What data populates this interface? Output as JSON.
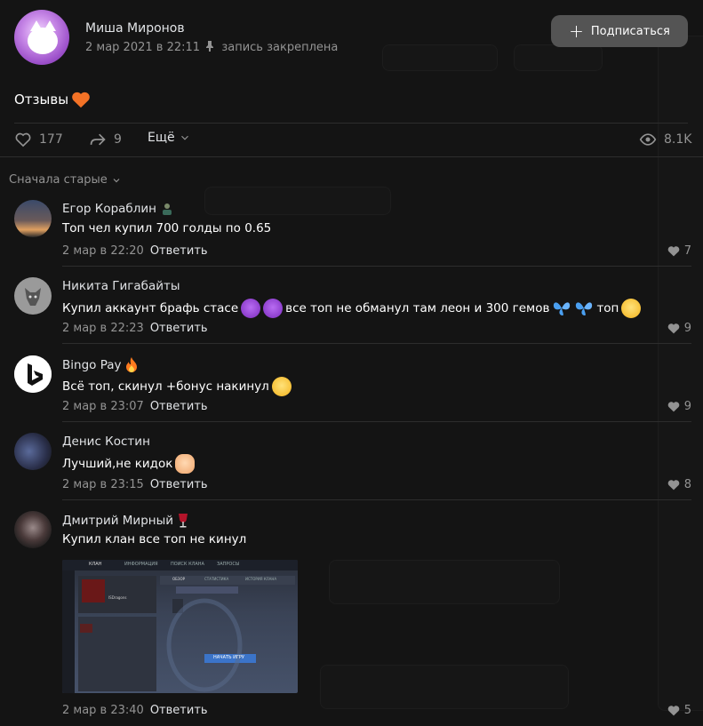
{
  "post": {
    "author": "Миша Миронов",
    "date": "2 мар 2021 в 22:11",
    "pinned_label": "запись закреплена",
    "subscribe_label": "Подписаться",
    "text": "Отзывы",
    "likes": "177",
    "shares": "9",
    "more_label": "Ещё",
    "views": "8.1K"
  },
  "sort_label": "Сначала старые",
  "reply_label": "Ответить",
  "comments": [
    {
      "name": "Егор Кораблин",
      "text": "Топ чел купил 700 голды по 0.65",
      "date": "2 мар в 22:20",
      "likes": "7"
    },
    {
      "name": "Никита Гигабайты",
      "text_a": "Купил аккаунт брафь стасе",
      "text_b": "все топ не обманул там леон и 300 гемов",
      "text_c": "топ",
      "date": "2 мар в 22:23",
      "likes": "9"
    },
    {
      "name": "Bingo  Pay",
      "text": "Всё топ, скинул +бонус накинул",
      "date": "2 мар в 23:07",
      "likes": "9"
    },
    {
      "name": "Денис Костин",
      "text": "Лучший,не кидок",
      "date": "2 мар в 23:15",
      "likes": "8"
    },
    {
      "name": "Дмитрий Мирный",
      "text": "Купил клан все топ не кинул",
      "date": "2 мар в 23:40",
      "likes": "5"
    }
  ],
  "game_screenshot": {
    "tabs": [
      "КЛАН",
      "ИНФОРМАЦИЯ",
      "ПОИСК КЛАНА",
      "ЗАПРОСЫ"
    ],
    "sub_tabs": [
      "ОБЗОР",
      "СТАТИСТИКА",
      "ИСТОРИЯ КЛАНА"
    ],
    "clan_name": "ISDragons",
    "button": "НАЧАТЬ ИГРУ"
  },
  "colors": {
    "background": "#141414",
    "accent_text": "#e1e3e6",
    "muted": "#939393",
    "button": "#545454"
  }
}
